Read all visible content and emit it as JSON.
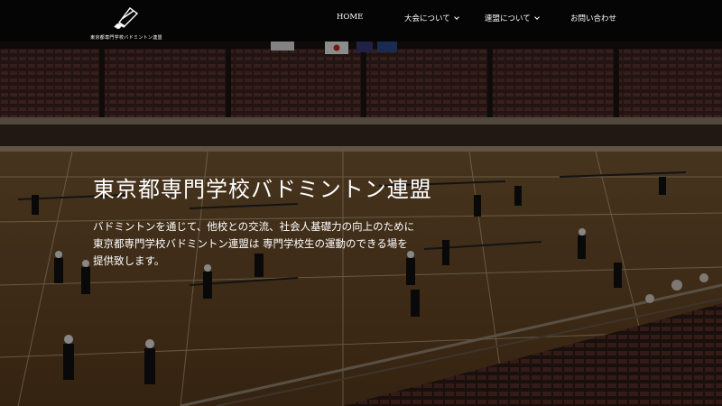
{
  "site": {
    "logo_text": "東京都専門学校バドミントン連盟"
  },
  "nav": {
    "items": [
      {
        "label": "HOME",
        "has_dropdown": false
      },
      {
        "label": "大会について",
        "has_dropdown": true
      },
      {
        "label": "連盟について",
        "has_dropdown": true
      },
      {
        "label": "お問い合わせ",
        "has_dropdown": false
      }
    ]
  },
  "hero": {
    "title": "東京都専門学校バドミントン連盟",
    "lines": [
      "バドミントンを通じて、他校との交流、社会人基礎力の向上のために",
      "東京都専門学校バドミントン連盟は 専門学校生の運動のできる場を",
      "提供致します。"
    ]
  },
  "colors": {
    "header_bg": "#050505",
    "court_floor": "#6b4a25",
    "text": "#ffffff"
  },
  "icons": [
    "shuttlecock-icon",
    "chevron-down-icon"
  ]
}
